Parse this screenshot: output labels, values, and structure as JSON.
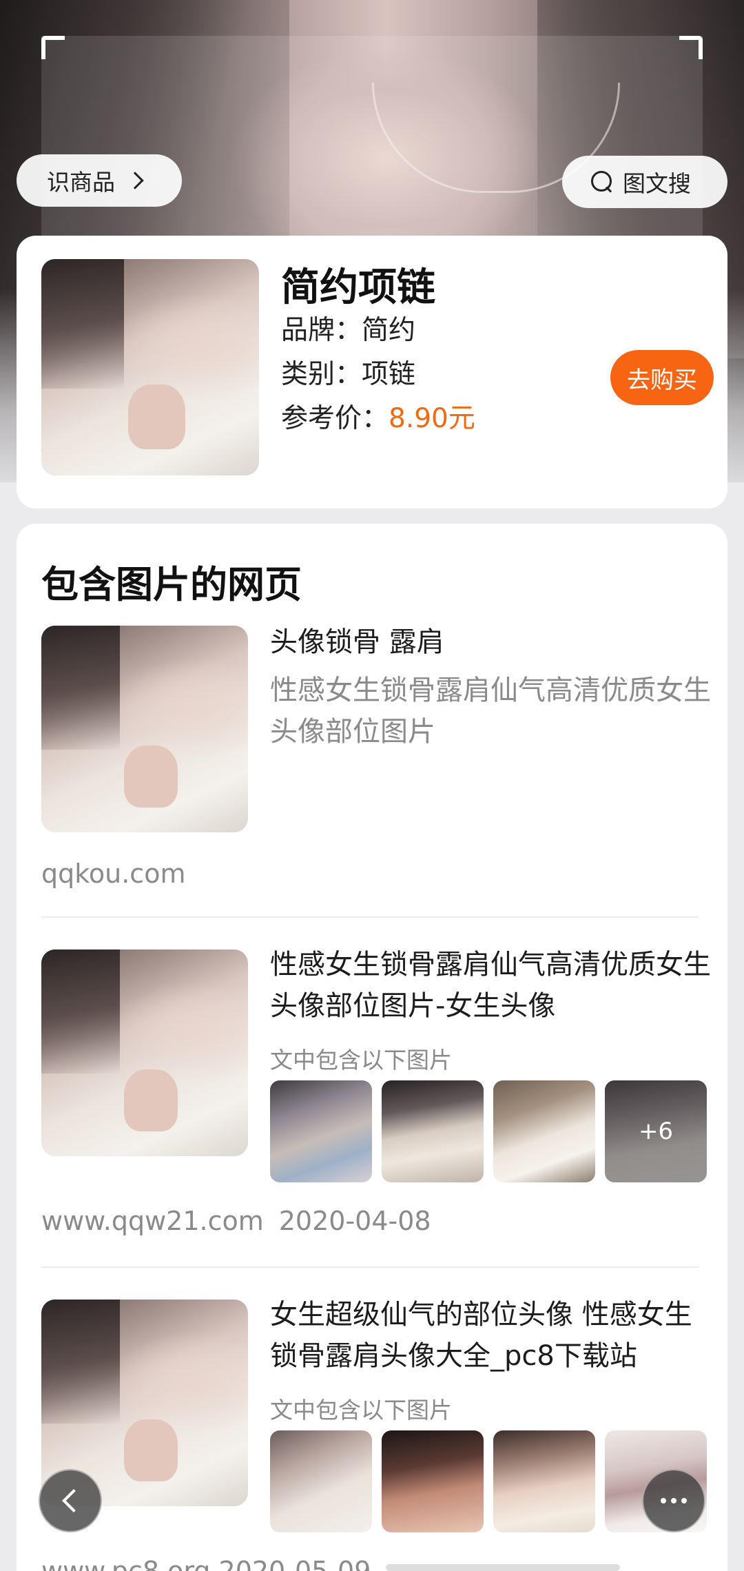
{
  "top_bar": {
    "identify_label": "识商品",
    "search_label": "图文搜"
  },
  "product": {
    "title": "简约项链",
    "brand_label": "品牌：",
    "brand_value": "简约",
    "category_label": "类别：",
    "category_value": "项链",
    "price_label": "参考价：",
    "price_value": "8.90元",
    "buy_label": "去购买",
    "accent_color": "#F86512"
  },
  "pages": {
    "section_title": "包含图片的网页",
    "results": [
      {
        "title": "头像锁骨 露肩",
        "subtitle": "性感女生锁骨露肩仙气高清优质女生头像部位图片",
        "source": "qqkou.com",
        "date": ""
      },
      {
        "title": "性感女生锁骨露肩仙气高清优质女生头像部位图片-女生头像",
        "note": "文中包含以下图片",
        "more_count": "+6",
        "source": "www.qqw21.com",
        "date": "2020-04-08"
      },
      {
        "title": "女生超级仙气的部位头像 性感女生锁骨露肩头像大全_pc8下载站",
        "note": "文中包含以下图片",
        "source": "www.pc8.org",
        "date": "2020-05-09"
      }
    ]
  },
  "icons": {
    "search": "search-icon",
    "chevron_right": "chevron-right-icon",
    "back": "chevron-left-icon",
    "more": "more-horizontal-icon"
  }
}
